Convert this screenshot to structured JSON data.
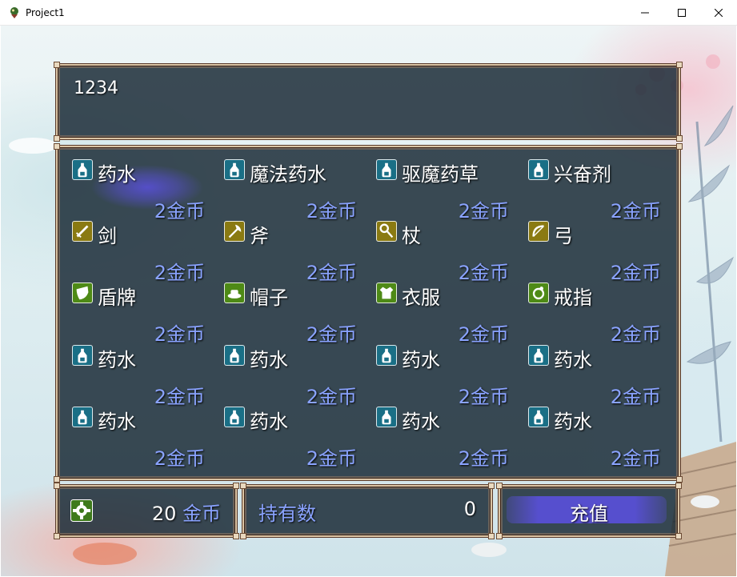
{
  "window": {
    "title": "Project1"
  },
  "help": {
    "text": "1234"
  },
  "shop": {
    "items": [
      {
        "name": "药水",
        "price": "2金币",
        "icon": "potion-icon",
        "color": "#1a6f86",
        "selected": true
      },
      {
        "name": "魔法药水",
        "price": "2金币",
        "icon": "potion-icon",
        "color": "#1a6f86"
      },
      {
        "name": "驱魔药草",
        "price": "2金币",
        "icon": "potion-icon",
        "color": "#1a6f86"
      },
      {
        "name": "兴奋剂",
        "price": "2金币",
        "icon": "potion-icon",
        "color": "#1a6f86"
      },
      {
        "name": "剑",
        "price": "2金币",
        "icon": "sword-icon",
        "color": "#8a7a12"
      },
      {
        "name": "斧",
        "price": "2金币",
        "icon": "axe-icon",
        "color": "#8a7a12"
      },
      {
        "name": "杖",
        "price": "2金币",
        "icon": "staff-icon",
        "color": "#8a7a12"
      },
      {
        "name": "弓",
        "price": "2金币",
        "icon": "bow-icon",
        "color": "#8a7a12"
      },
      {
        "name": "盾牌",
        "price": "2金币",
        "icon": "shield-icon",
        "color": "#4e8a16"
      },
      {
        "name": "帽子",
        "price": "2金币",
        "icon": "hat-icon",
        "color": "#4e8a16"
      },
      {
        "name": "衣服",
        "price": "2金币",
        "icon": "clothes-icon",
        "color": "#4e8a16"
      },
      {
        "name": "戒指",
        "price": "2金币",
        "icon": "ring-icon",
        "color": "#4e8a16"
      },
      {
        "name": "药水",
        "price": "2金币",
        "icon": "potion-icon",
        "color": "#1a6f86"
      },
      {
        "name": "药水",
        "price": "2金币",
        "icon": "potion-icon",
        "color": "#1a6f86"
      },
      {
        "name": "药水",
        "price": "2金币",
        "icon": "potion-icon",
        "color": "#1a6f86"
      },
      {
        "name": "药水",
        "price": "2金币",
        "icon": "potion-icon",
        "color": "#1a6f86"
      },
      {
        "name": "药水",
        "price": "2金币",
        "icon": "potion-icon",
        "color": "#1a6f86"
      },
      {
        "name": "药水",
        "price": "2金币",
        "icon": "potion-icon",
        "color": "#1a6f86"
      },
      {
        "name": "药水",
        "price": "2金币",
        "icon": "potion-icon",
        "color": "#1a6f86"
      },
      {
        "name": "药水",
        "price": "2金币",
        "icon": "potion-icon",
        "color": "#1a6f86"
      }
    ]
  },
  "gold": {
    "icon": "gear-icon",
    "amount": "20",
    "unit": "金币"
  },
  "possession": {
    "label": "持有数",
    "value": "0"
  },
  "recharge": {
    "label": "充值"
  },
  "colors": {
    "price_text": "#8aa3ff",
    "frame_border": "#d9c3a4",
    "selection": "#5a50dc"
  }
}
